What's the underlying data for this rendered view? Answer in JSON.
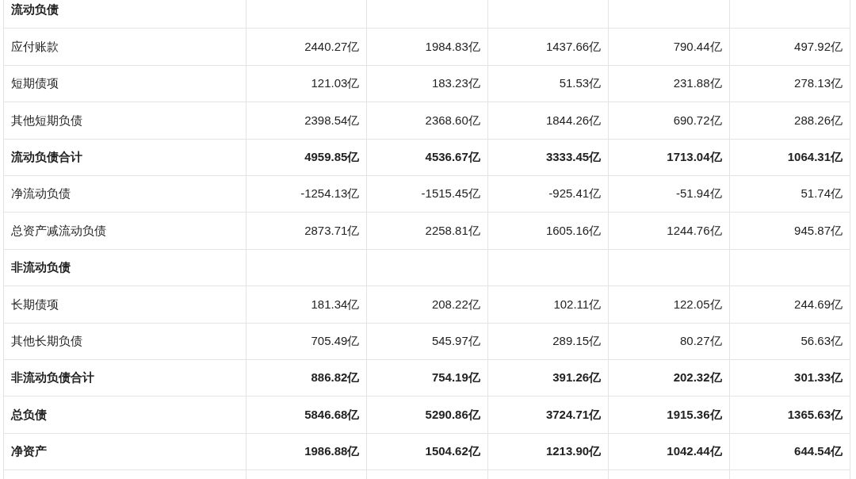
{
  "rows": [
    {
      "kind": "section",
      "label": "流动负债",
      "values": []
    },
    {
      "kind": "item",
      "label": "应付账款",
      "values": [
        "2440.27亿",
        "1984.83亿",
        "1437.66亿",
        "790.44亿",
        "497.92亿"
      ]
    },
    {
      "kind": "item",
      "label": "短期债项",
      "values": [
        "121.03亿",
        "183.23亿",
        "51.53亿",
        "231.88亿",
        "278.13亿"
      ]
    },
    {
      "kind": "item",
      "label": "其他短期负债",
      "values": [
        "2398.54亿",
        "2368.60亿",
        "1844.26亿",
        "690.72亿",
        "288.26亿"
      ]
    },
    {
      "kind": "total",
      "label": "流动负债合计",
      "values": [
        "4959.85亿",
        "4536.67亿",
        "3333.45亿",
        "1713.04亿",
        "1064.31亿"
      ]
    },
    {
      "kind": "item",
      "label": "净流动负债",
      "values": [
        "-1254.13亿",
        "-1515.45亿",
        "-925.41亿",
        "-51.94亿",
        "51.74亿"
      ]
    },
    {
      "kind": "item",
      "label": "总资产减流动负债",
      "values": [
        "2873.71亿",
        "2258.81亿",
        "1605.16亿",
        "1244.76亿",
        "945.87亿"
      ]
    },
    {
      "kind": "section",
      "label": "非流动负债",
      "values": []
    },
    {
      "kind": "item",
      "label": "长期债项",
      "values": [
        "181.34亿",
        "208.22亿",
        "102.11亿",
        "122.05亿",
        "244.69亿"
      ]
    },
    {
      "kind": "item",
      "label": "其他长期负债",
      "values": [
        "705.49亿",
        "545.97亿",
        "289.15亿",
        "80.27亿",
        "56.63亿"
      ]
    },
    {
      "kind": "total",
      "label": "非流动负债合计",
      "values": [
        "886.82亿",
        "754.19亿",
        "391.26亿",
        "202.32亿",
        "301.33亿"
      ]
    },
    {
      "kind": "total",
      "label": "总负债",
      "values": [
        "5846.68亿",
        "5290.86亿",
        "3724.71亿",
        "1915.36亿",
        "1365.63亿"
      ]
    },
    {
      "kind": "total",
      "label": "净资产",
      "values": [
        "1986.88亿",
        "1504.62亿",
        "1213.90亿",
        "1042.44亿",
        "644.54亿"
      ]
    }
  ]
}
